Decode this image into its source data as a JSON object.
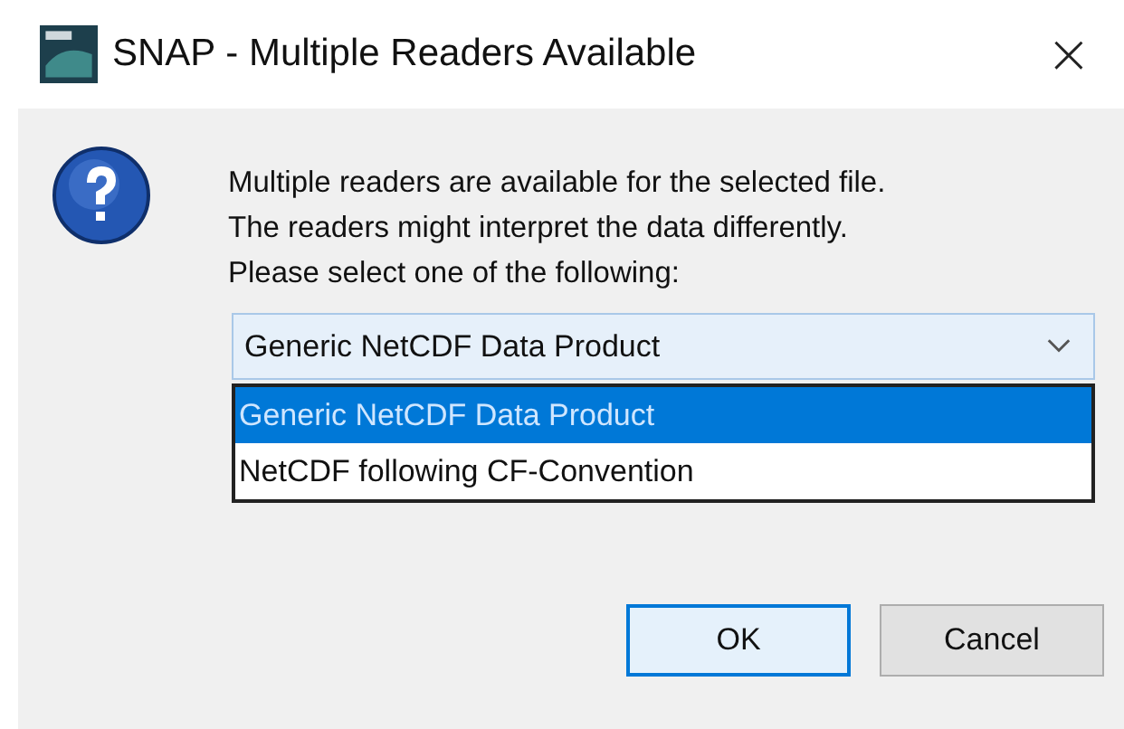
{
  "window": {
    "title": "SNAP - Multiple Readers Available",
    "close": "×"
  },
  "message": [
    "Multiple readers are available for the selected file.",
    "The readers might interpret the data differently.",
    "Please select one of the following:"
  ],
  "combo": {
    "value": "Generic NetCDF Data Product",
    "expanded": true,
    "options": [
      {
        "label": "Generic NetCDF Data Product",
        "selected": true
      },
      {
        "label": "NetCDF following CF-Convention",
        "selected": false
      }
    ]
  },
  "buttons": [
    {
      "label": "OK",
      "default": true
    },
    {
      "label": "Cancel",
      "default": false
    }
  ]
}
